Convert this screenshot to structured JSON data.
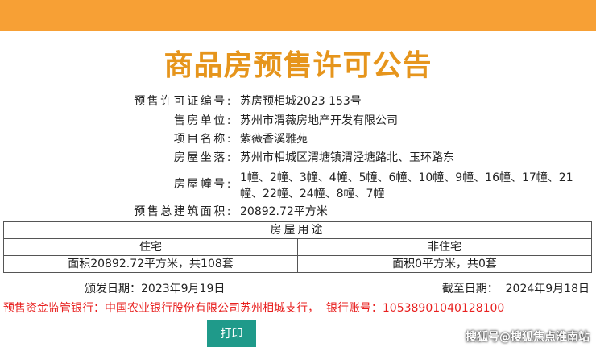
{
  "colors": {
    "top_bar": "#f7a035",
    "title": "#e6951c",
    "accent_red": "#e8201f",
    "button": "#1f9a8a"
  },
  "title": "商品房预售许可公告",
  "fields": [
    {
      "label": "预售许可证编号:",
      "value": "苏房预相城2023 153号"
    },
    {
      "label": "售房单位:",
      "value": "苏州市渭薇房地产开发有限公司"
    },
    {
      "label": "项目名称:",
      "value": "紫薇香溪雅苑"
    },
    {
      "label": "房屋坐落:",
      "value": "苏州市相城区渭塘镇渭泾塘路北、玉环路东"
    },
    {
      "label": "房屋幢号:",
      "value": "1幢、2幢、3幢、4幢、5幢、6幢、10幢、9幢、16幢、17幢、21幢、22幢、24幢、8幢、7幢"
    },
    {
      "label": "预售总建筑面积:",
      "value": "20892.72平方米"
    }
  ],
  "usage_table": {
    "header": "房屋用途",
    "columns": [
      "住宅",
      "非住宅"
    ],
    "values": [
      "面积20892.72平方米，共108套",
      "面积0平方米，共0套"
    ]
  },
  "issue_date": "颁发日期：2023年9月19日",
  "expiry_date": "截至日期：  2024年9月18日",
  "bank_line": "预售资金监管银行：中国农业银行股份有限公司苏州相城支行，  银行账号：10538901040128100",
  "print_label": "打印",
  "watermark": "搜狐号@搜狐焦点淮南站"
}
